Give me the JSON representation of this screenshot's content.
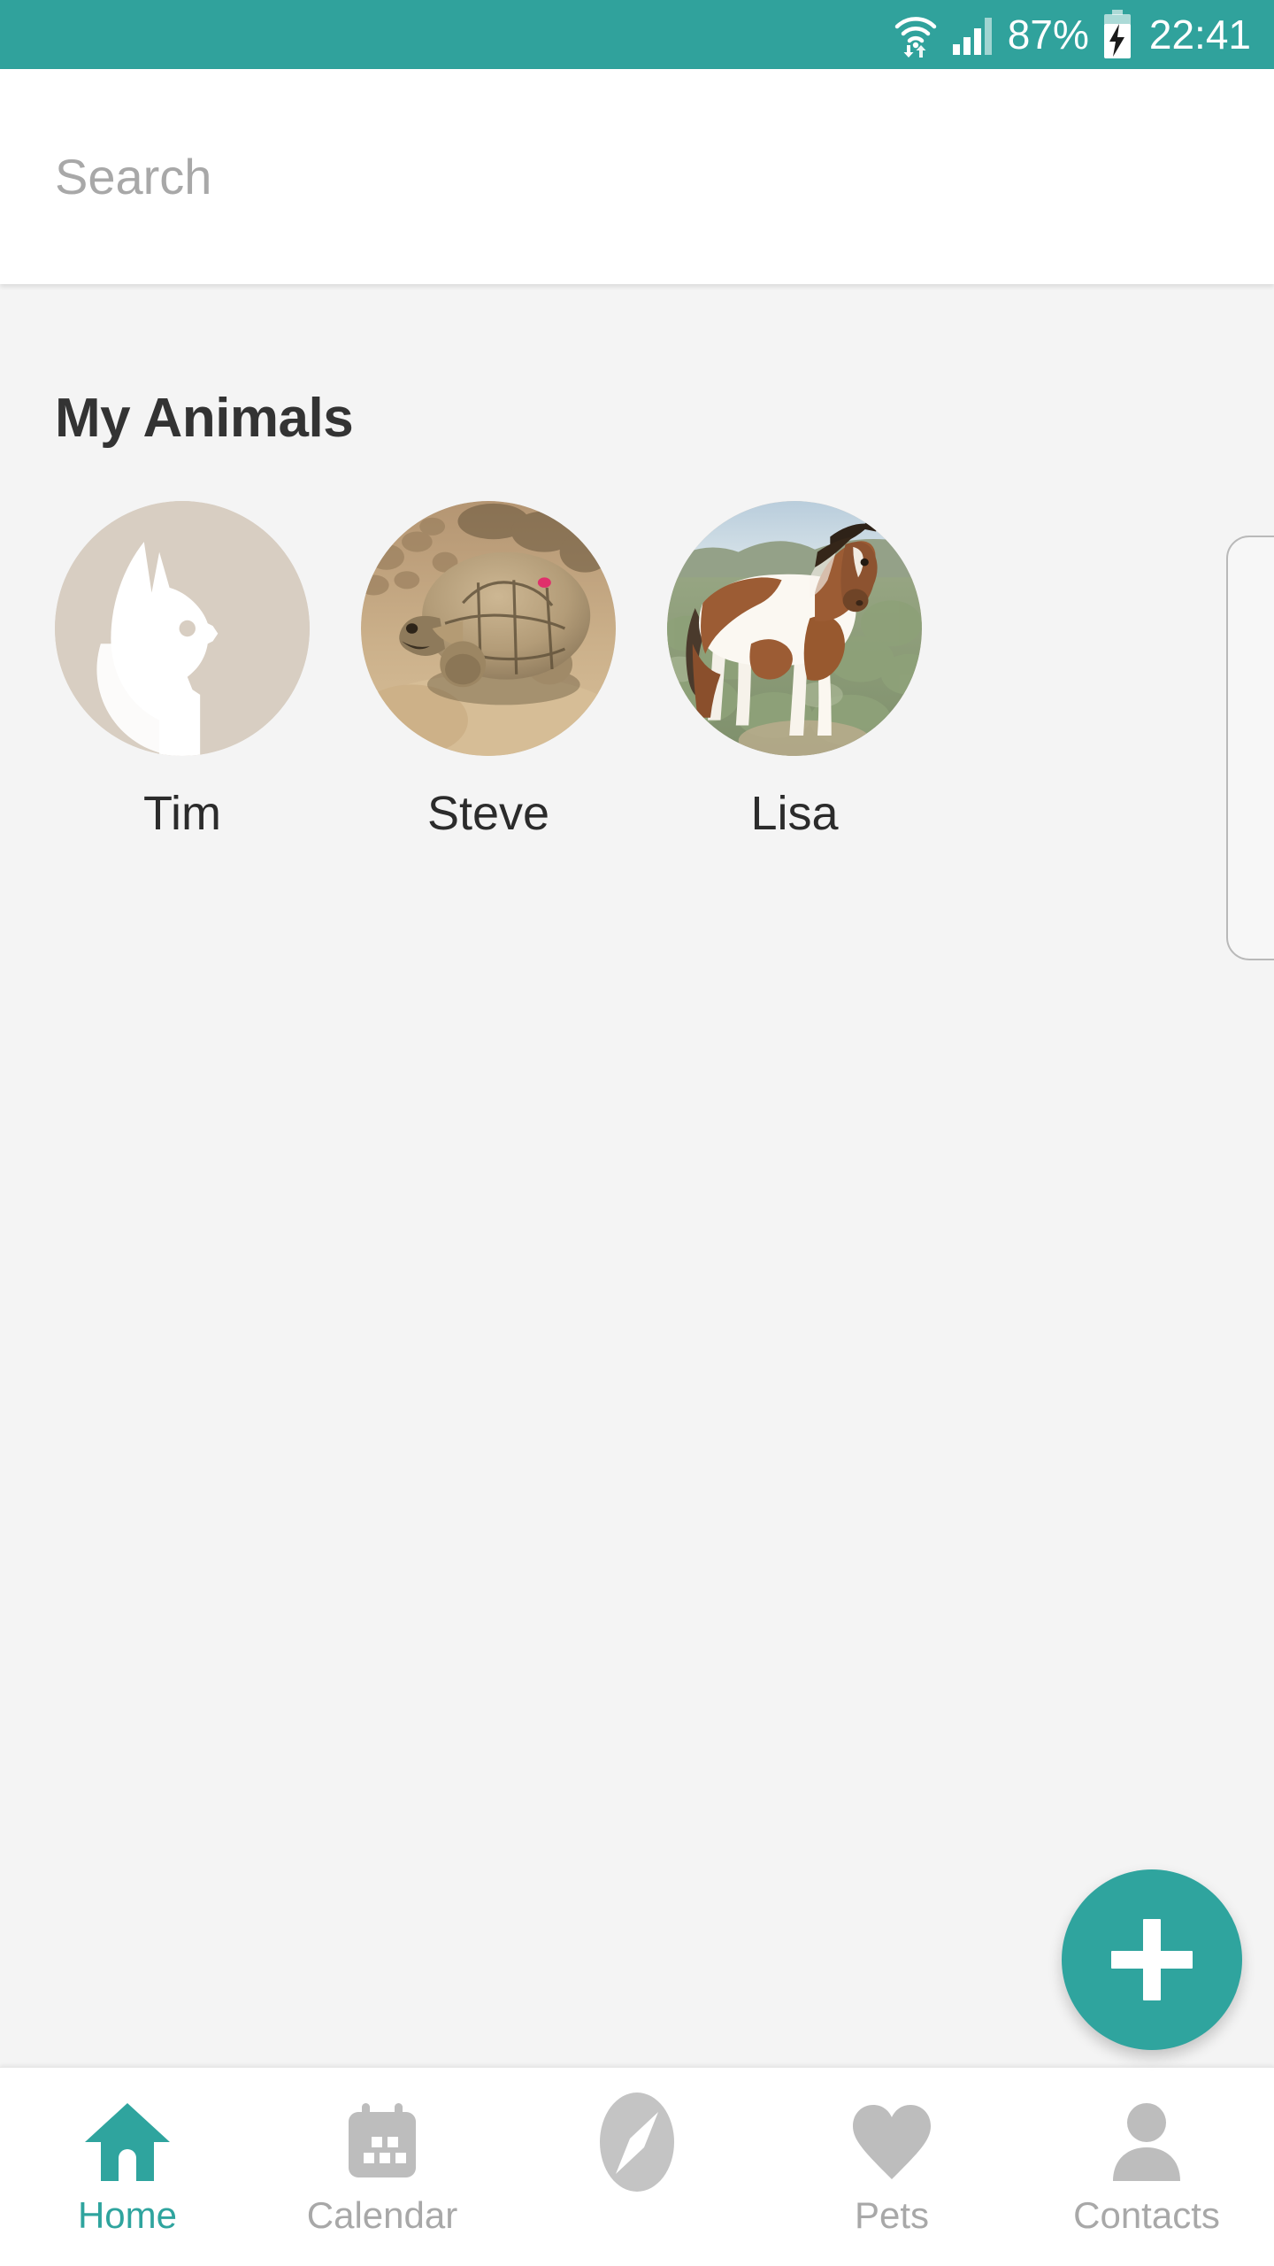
{
  "status_bar": {
    "wifi_icon": "wifi-icon",
    "signal_icon": "cellular-signal-icon",
    "battery_percent": "87%",
    "battery_icon": "battery-charging-icon",
    "clock": "22:41",
    "background_color": "#30a29c"
  },
  "search": {
    "placeholder": "Search",
    "value": ""
  },
  "main": {
    "section_title": "My Animals",
    "animals": [
      {
        "name": "Tim",
        "avatar_type": "dog-placeholder-icon"
      },
      {
        "name": "Steve",
        "avatar_type": "tortoise-photo"
      },
      {
        "name": "Lisa",
        "avatar_type": "horse-photo"
      }
    ]
  },
  "fab": {
    "label": "+",
    "icon": "plus-icon",
    "color": "#2fa49e"
  },
  "bottom_nav": {
    "active_color": "#2fa49e",
    "inactive_color": "#bdbdbd",
    "items": [
      {
        "label": "Home",
        "icon": "home-icon",
        "active": true
      },
      {
        "label": "Calendar",
        "icon": "calendar-icon",
        "active": false
      },
      {
        "label": "",
        "icon": "compass-icon",
        "active": false
      },
      {
        "label": "Pets",
        "icon": "heart-icon",
        "active": false
      },
      {
        "label": "Contacts",
        "icon": "person-icon",
        "active": false
      }
    ]
  }
}
